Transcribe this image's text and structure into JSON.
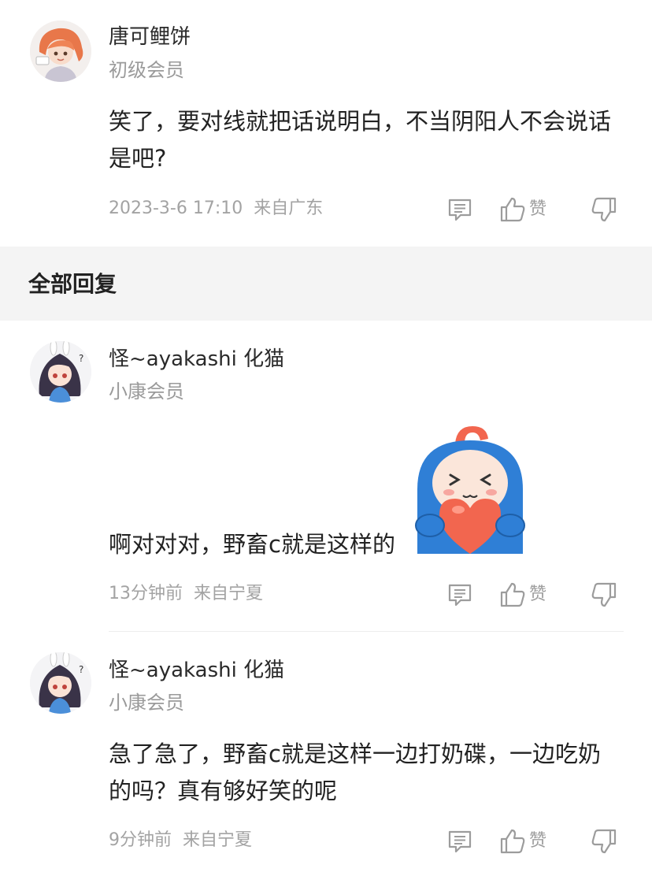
{
  "main_comment": {
    "username": "唐可鲤饼",
    "level": "初级会员",
    "text": "笑了，要对线就把话说明白，不当阴阳人不会说话是吧?",
    "time": "2023-3-6 17:10",
    "location": "来自广东",
    "like_label": "赞"
  },
  "section": {
    "title": "全部回复"
  },
  "replies": [
    {
      "username": "怪~ayakashi 化猫",
      "level": "小康会员",
      "text": "啊对对对，野畜c就是这样的",
      "sticker": "heart-hug-sticker",
      "time": "13分钟前",
      "location": "来自宁夏",
      "like_label": "赞"
    },
    {
      "username": "怪~ayakashi 化猫",
      "level": "小康会员",
      "text": "急了急了，野畜c就是这样一边打奶碟，一边吃奶的吗？真有够好笑的呢",
      "time": "9分钟前",
      "location": "来自宁夏",
      "like_label": "赞"
    }
  ],
  "icons": {
    "reply": "reply-icon",
    "like": "thumbs-up-icon",
    "dislike": "thumbs-down-icon"
  },
  "colors": {
    "section_bg": "#f4f4f4",
    "meta_text": "#a3a3a3",
    "sticker_blue": "#2f7fd6",
    "sticker_heart": "#f2664f"
  }
}
